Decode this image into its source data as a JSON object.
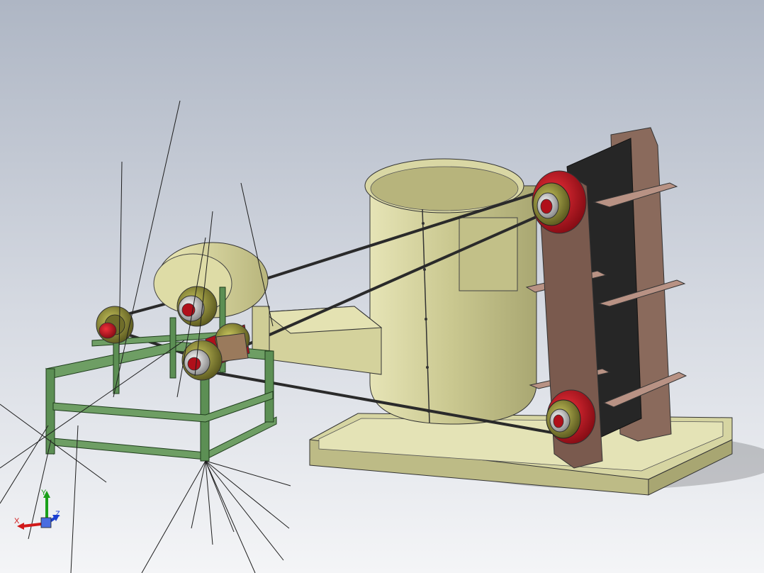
{
  "viewport": {
    "background_top": "#aeb6c4",
    "background_mid": "#d6dae2",
    "background_bottom": "#f4f5f7"
  },
  "colors": {
    "hopper": "#c9c78f",
    "hopper_dark": "#9f9d6a",
    "hopper_light": "#e0dfb0",
    "base_plate": "#d6d5a2",
    "frame": "#5c8f54",
    "frame_dark": "#3d6a3a",
    "elevator_side": "#7a5a4e",
    "elevator_belt": "#2c2c2c",
    "bucket": "#b89284",
    "pulley_red": "#b0101a",
    "pulley_olive": "#7e7c32",
    "belt": "#2a2a2a",
    "fan_housing": "#d9d59a"
  },
  "triad": {
    "axes": [
      {
        "name": "X",
        "color": "#d11a1a"
      },
      {
        "name": "Y",
        "color": "#1aa01a"
      },
      {
        "name": "Z",
        "color": "#1a3fd1"
      }
    ]
  }
}
